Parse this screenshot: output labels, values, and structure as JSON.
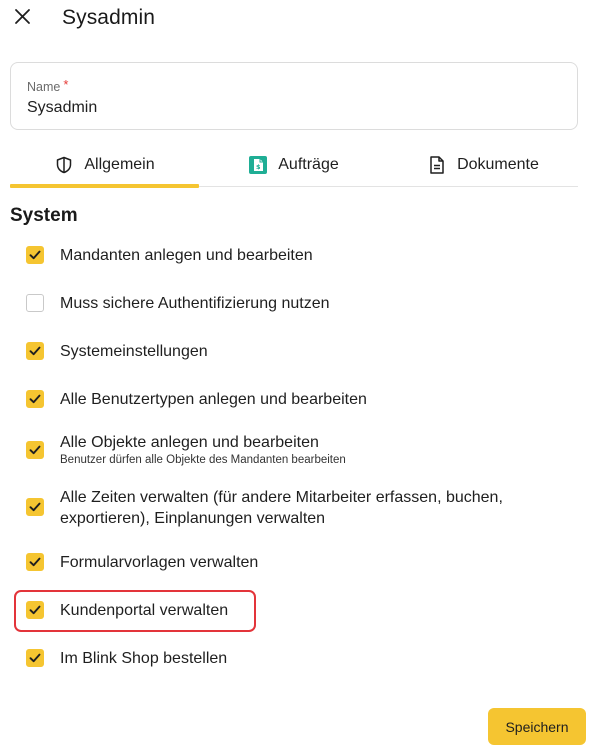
{
  "header": {
    "title": "Sysadmin",
    "close_icon": "close-icon"
  },
  "name_field": {
    "label": "Name",
    "required_marker": "*",
    "value": "Sysadmin"
  },
  "tabs": [
    {
      "label": "Allgemein",
      "icon": "shield-icon",
      "active": true
    },
    {
      "label": "Aufträge",
      "icon": "order-document-icon",
      "active": false
    },
    {
      "label": "Dokumente",
      "icon": "document-icon",
      "active": false
    }
  ],
  "section": {
    "title": "System"
  },
  "permissions": [
    {
      "label": "Mandanten anlegen und bearbeiten",
      "checked": true
    },
    {
      "label": "Muss sichere Authentifizierung nutzen",
      "checked": false
    },
    {
      "label": "Systemeinstellungen",
      "checked": true
    },
    {
      "label": "Alle Benutzertypen anlegen und bearbeiten",
      "checked": true
    },
    {
      "label": "Alle Objekte anlegen und bearbeiten",
      "sublabel": "Benutzer dürfen alle Objekte des Mandanten bearbeiten",
      "checked": true
    },
    {
      "label": "Alle Zeiten verwalten (für andere Mitarbeiter erfassen, buchen, exportieren), Einplanungen verwalten",
      "checked": true
    },
    {
      "label": "Formularvorlagen verwalten",
      "checked": true
    },
    {
      "label": "Kundenportal verwalten",
      "checked": true,
      "highlighted": true
    },
    {
      "label": "Im Blink Shop bestellen",
      "checked": true
    }
  ],
  "footer": {
    "save_label": "Speichern"
  },
  "colors": {
    "accent": "#f5c531",
    "highlight": "#e3343a",
    "tab_icon_teal": "#1fae95"
  }
}
